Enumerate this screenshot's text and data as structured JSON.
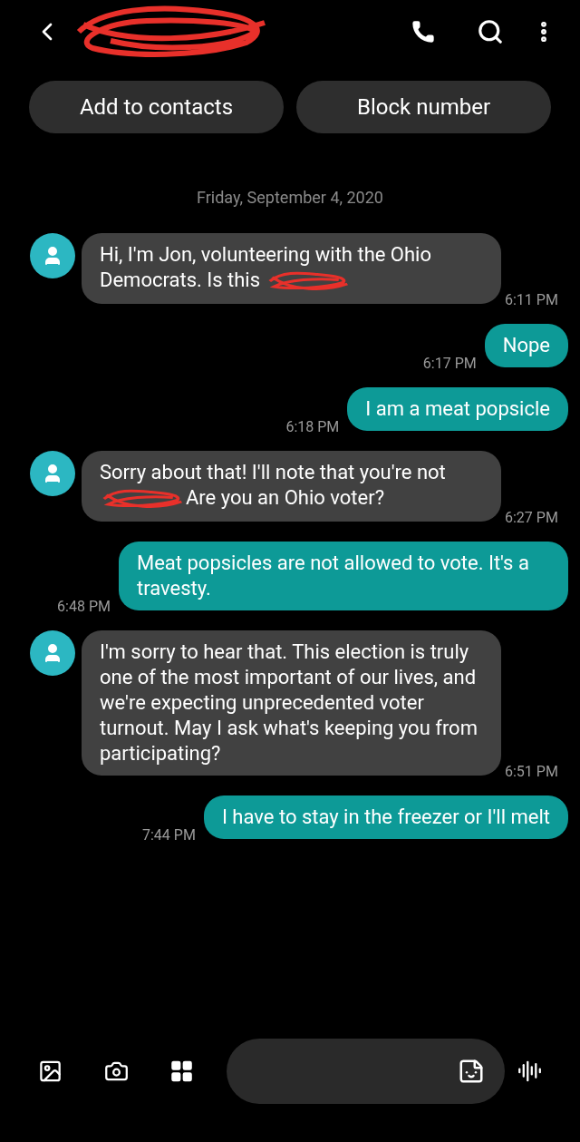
{
  "header_buttons": [
    "Add to contacts",
    "Block number"
  ],
  "date": "Friday, September 4, 2020",
  "messages": [
    {
      "kind": "incoming",
      "time": "6:11 PM",
      "parts": [
        {
          "kind": "text",
          "text": "Hi, I'm Jon, volunteering with the Ohio"
        },
        {
          "kind": "text",
          "text": "Democrats. Is this"
        },
        {
          "kind": "redaction"
        }
      ]
    },
    {
      "kind": "outgoing",
      "time": "6:17 PM",
      "parts": [
        {
          "kind": "text",
          "text": "Nope"
        }
      ]
    },
    {
      "kind": "outgoing",
      "time": "6:18 PM",
      "parts": [
        {
          "kind": "text",
          "text": "I am a meat popsicle"
        }
      ]
    },
    {
      "kind": "incoming",
      "time": "6:27 PM",
      "parts": [
        {
          "kind": "text",
          "text": "Sorry about that! I'll note that you're not"
        },
        {
          "kind": "redaction"
        },
        {
          "kind": "text",
          "text": "Are you an Ohio voter?"
        }
      ]
    },
    {
      "kind": "outgoing",
      "time": "6:48 PM",
      "parts": [
        {
          "kind": "text",
          "text": "Meat popsicles are not allowed to vote. It's a travesty."
        }
      ]
    },
    {
      "kind": "incoming",
      "time": "6:51 PM",
      "parts": [
        {
          "kind": "text",
          "text": "I'm sorry to hear that. This election is truly one of the most important of our lives, and we're expecting unprecedented voter turnout. May I ask what's keeping you from participating?"
        }
      ]
    },
    {
      "kind": "outgoing",
      "time": "7:44 PM",
      "parts": [
        {
          "kind": "text",
          "text": "I have to stay in the freezer or I'll melt"
        }
      ]
    }
  ]
}
